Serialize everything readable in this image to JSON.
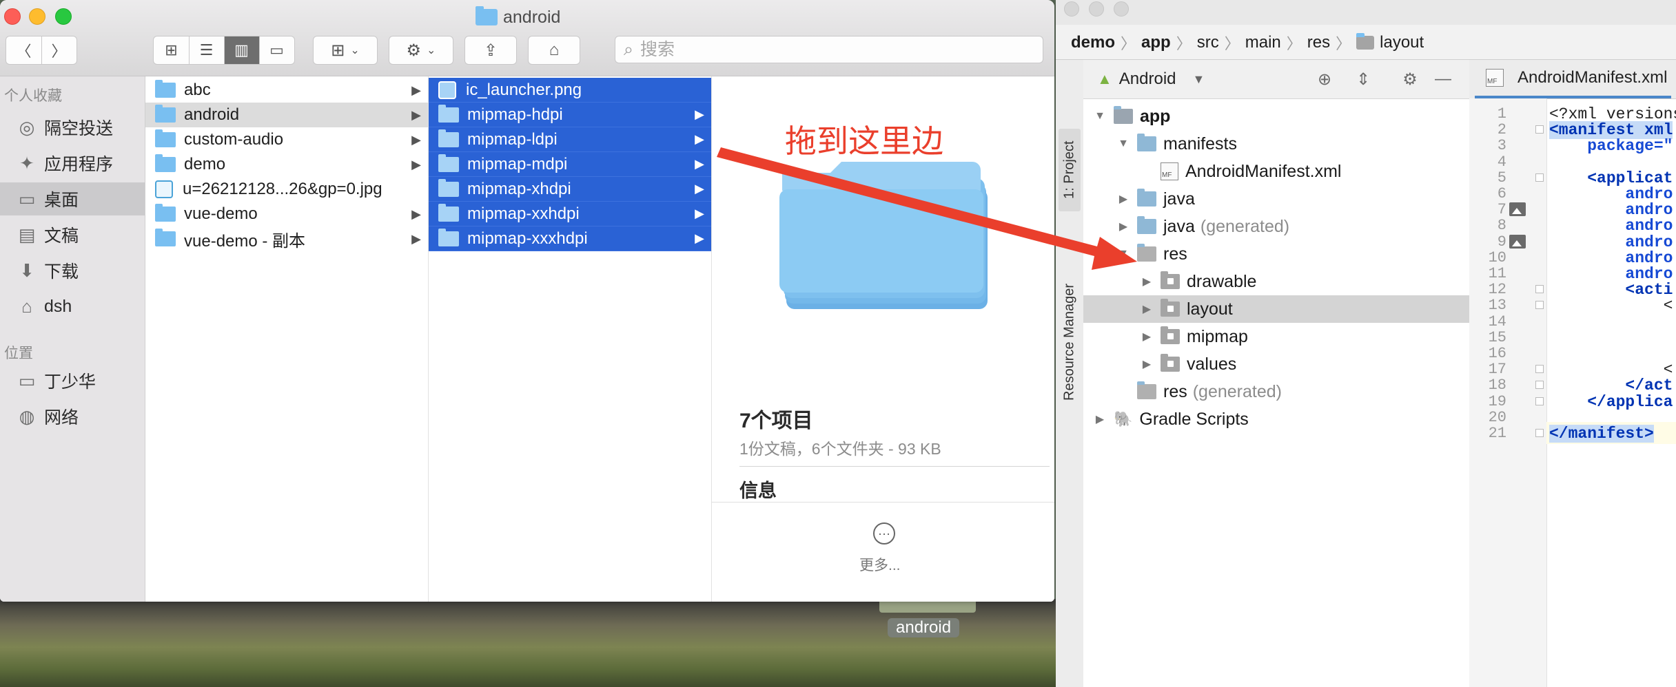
{
  "finder": {
    "title": "android",
    "search_placeholder": "搜索",
    "sidebar": {
      "favorites_header": "个人收藏",
      "favorites": [
        {
          "label": "隔空投送",
          "icon": "airdrop-icon"
        },
        {
          "label": "应用程序",
          "icon": "applications-icon"
        },
        {
          "label": "桌面",
          "icon": "desktop-icon",
          "selected": true
        },
        {
          "label": "文稿",
          "icon": "documents-icon"
        },
        {
          "label": "下载",
          "icon": "downloads-icon"
        },
        {
          "label": "dsh",
          "icon": "home-icon"
        }
      ],
      "locations_header": "位置",
      "locations": [
        {
          "label": "丁少华",
          "icon": "laptop-icon"
        },
        {
          "label": "网络",
          "icon": "network-icon"
        }
      ]
    },
    "column1": [
      {
        "label": "abc",
        "type": "folder"
      },
      {
        "label": "android",
        "type": "folder",
        "selected": true
      },
      {
        "label": "custom-audio",
        "type": "folder"
      },
      {
        "label": "demo",
        "type": "folder"
      },
      {
        "label": "u=26212128...26&gp=0.jpg",
        "type": "image"
      },
      {
        "label": "vue-demo",
        "type": "folder"
      },
      {
        "label": "vue-demo - 副本",
        "type": "folder"
      }
    ],
    "column2": [
      {
        "label": "ic_launcher.png",
        "type": "image"
      },
      {
        "label": "mipmap-hdpi",
        "type": "folder"
      },
      {
        "label": "mipmap-ldpi",
        "type": "folder"
      },
      {
        "label": "mipmap-mdpi",
        "type": "folder"
      },
      {
        "label": "mipmap-xhdpi",
        "type": "folder"
      },
      {
        "label": "mipmap-xxhdpi",
        "type": "folder"
      },
      {
        "label": "mipmap-xxxhdpi",
        "type": "folder"
      }
    ],
    "preview": {
      "drag_hint": "拖到这里边",
      "count": "7个项目",
      "subtitle": "1份文稿，6个文件夹 - 93 KB",
      "info_label": "信息",
      "more_label": "更多..."
    }
  },
  "desktop": {
    "icon_label": "android"
  },
  "studio": {
    "breadcrumbs": [
      {
        "label": "demo",
        "bold": true
      },
      {
        "label": "app",
        "bold": true
      },
      {
        "label": "src"
      },
      {
        "label": "main"
      },
      {
        "label": "res"
      },
      {
        "label": "layout",
        "folder": true
      }
    ],
    "side_tabs": {
      "project": "1: Project",
      "resource_manager": "Resource Manager"
    },
    "project_view": "Android",
    "tree": [
      {
        "label": "app",
        "depth": 0,
        "twisty": "▼",
        "icon": "module",
        "bold": true
      },
      {
        "label": "manifests",
        "depth": 1,
        "twisty": "▼",
        "icon": "folder"
      },
      {
        "label": "AndroidManifest.xml",
        "depth": 2,
        "twisty": "",
        "icon": "manifest"
      },
      {
        "label": "java",
        "depth": 1,
        "twisty": "▶",
        "icon": "folder"
      },
      {
        "label": "java",
        "suffix": "(generated)",
        "depth": 1,
        "twisty": "▶",
        "icon": "folder"
      },
      {
        "label": "res",
        "depth": 1,
        "twisty": "▼",
        "icon": "res"
      },
      {
        "label": "drawable",
        "depth": 2,
        "twisty": "▶",
        "icon": "grey"
      },
      {
        "label": "layout",
        "depth": 2,
        "twisty": "▶",
        "icon": "grey",
        "selected": true
      },
      {
        "label": "mipmap",
        "depth": 2,
        "twisty": "▶",
        "icon": "grey"
      },
      {
        "label": "values",
        "depth": 2,
        "twisty": "▶",
        "icon": "grey"
      },
      {
        "label": "res",
        "suffix": "(generated)",
        "depth": 1,
        "twisty": "",
        "icon": "res"
      },
      {
        "label": "Gradle Scripts",
        "depth": 0,
        "twisty": "▶",
        "icon": "gradle"
      }
    ],
    "editor_tab": "AndroidManifest.xml",
    "code_lines": [
      "<?xml versions",
      "<manifest xml",
      "    package=\"",
      "",
      "    <applicat",
      "        andro",
      "        andro",
      "        andro",
      "        andro",
      "        andro",
      "        andro",
      "        <acti",
      "            <",
      "",
      "",
      "",
      "            <",
      "        </act",
      "    </applica",
      "",
      "</manifest>"
    ],
    "gutter_images": [
      7,
      9
    ],
    "fold_lines": [
      2,
      5,
      12,
      13,
      17,
      18,
      19,
      21
    ],
    "current_line": 21
  },
  "colors": {
    "selection_blue": "#2a62d5",
    "folder_blue": "#79bff1",
    "annotation_red": "#ea3f2c"
  }
}
